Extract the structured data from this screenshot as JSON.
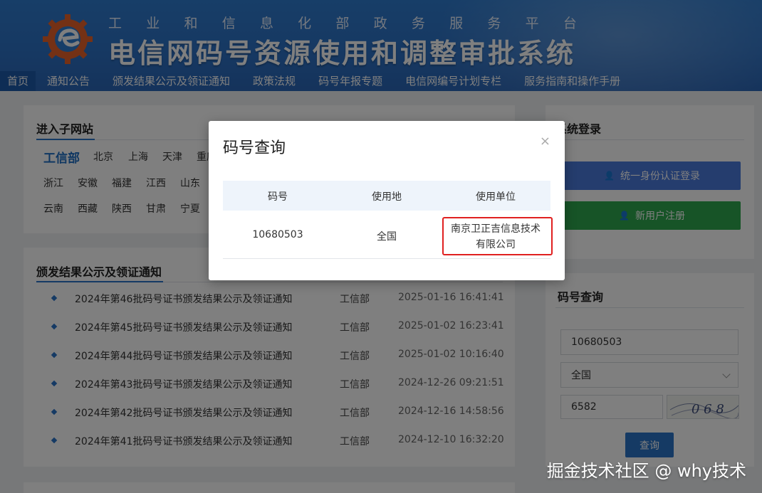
{
  "header": {
    "subtitle_chars": [
      "工",
      "业",
      "和",
      "信",
      "息",
      "化",
      "部",
      "政",
      "务",
      "服",
      "务",
      "平",
      "台"
    ],
    "title": "电信网码号资源使用和调整审批系统"
  },
  "nav": {
    "items": [
      "首页",
      "通知公告",
      "颁发结果公示及领证通知",
      "政策法规",
      "码号年报专题",
      "电信网编号计划专栏",
      "服务指南和操作手册"
    ]
  },
  "subsite": {
    "title": "进入子网站",
    "main": "工信部",
    "row1": [
      "北京",
      "上海",
      "天津",
      "重庆"
    ],
    "row2": [
      "浙江",
      "安徽",
      "福建",
      "江西",
      "山东"
    ],
    "row3": [
      "云南",
      "西藏",
      "陕西",
      "甘肃",
      "宁夏"
    ]
  },
  "notices": {
    "title": "颁发结果公示及领证通知",
    "rows": [
      {
        "title": "2024年第46批码号证书颁发结果公示及领证通知",
        "source": "工信部",
        "date": "2025-01-16 16:41:41"
      },
      {
        "title": "2024年第45批码号证书颁发结果公示及领证通知",
        "source": "工信部",
        "date": "2025-01-02 16:23:41"
      },
      {
        "title": "2024年第44批码号证书颁发结果公示及领证通知",
        "source": "工信部",
        "date": "2025-01-02 10:16:40"
      },
      {
        "title": "2024年第43批码号证书颁发结果公示及领证通知",
        "source": "工信部",
        "date": "2024-12-26 09:21:51"
      },
      {
        "title": "2024年第42批码号证书颁发结果公示及领证通知",
        "source": "工信部",
        "date": "2024-12-16 14:58:56"
      },
      {
        "title": "2024年第41批码号证书颁发结果公示及领证通知",
        "source": "工信部",
        "date": "2024-12-10 16:32:20"
      }
    ]
  },
  "login": {
    "title": "系统登录",
    "unified_label": "统一身份认证登录",
    "register_label": "新用户注册"
  },
  "query": {
    "title": "码号查询",
    "number_value": "10680503",
    "region_value": "全国",
    "captcha_input": "6582",
    "captcha_image_text": "0 6 8",
    "submit_label": "查询"
  },
  "modal": {
    "title": "码号查询",
    "close": "×",
    "headers": [
      "码号",
      "使用地",
      "使用单位"
    ],
    "row": {
      "number": "10680503",
      "region": "全国",
      "unit_line1": "南京卫正吉信息技术",
      "unit_line2": "有限公司"
    }
  },
  "watermark": "掘金技术社区 @ why技术",
  "colors": {
    "brand_blue": "#2b74c8",
    "login_blue": "#4a7bdd",
    "register_green": "#2fa84e",
    "highlight_red": "#e02020"
  }
}
